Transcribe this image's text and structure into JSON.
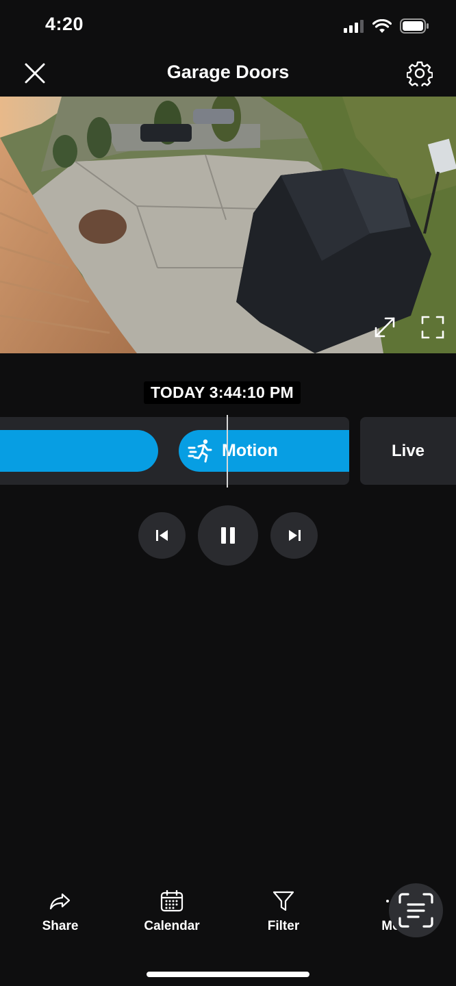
{
  "status_bar": {
    "time": "4:20"
  },
  "header": {
    "title": "Garage Doors"
  },
  "player": {
    "timestamp": "TODAY 3:44:10 PM"
  },
  "timeline": {
    "event_label": "Motion",
    "live_label": "Live"
  },
  "toolbar": {
    "items": [
      {
        "label": "Share",
        "icon": "share-icon"
      },
      {
        "label": "Calendar",
        "icon": "calendar-icon"
      },
      {
        "label": "Filter",
        "icon": "filter-icon"
      },
      {
        "label": "Mo",
        "icon": "more-icon"
      }
    ]
  },
  "colors": {
    "accent": "#079EE3",
    "background": "#0E0E0F",
    "panel": "#25262A"
  }
}
